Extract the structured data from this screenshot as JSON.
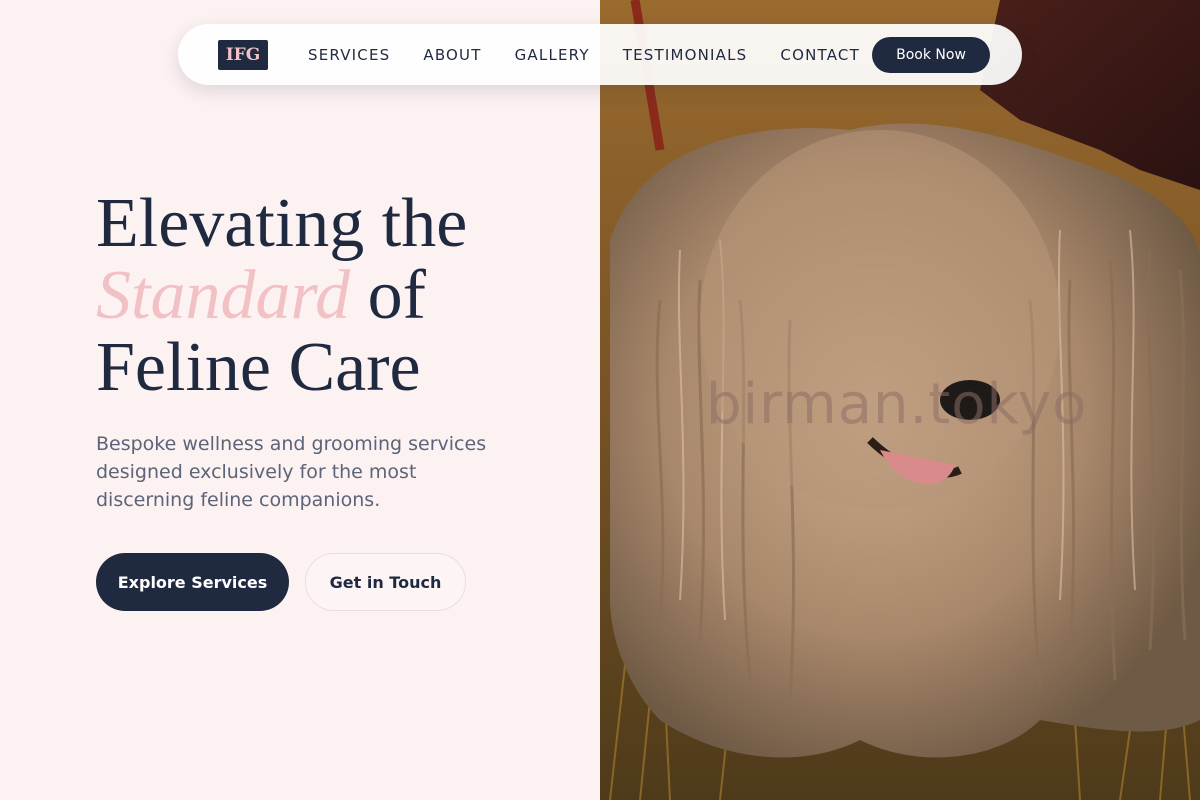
{
  "nav": {
    "logo": "IFG",
    "links": [
      "SERVICES",
      "ABOUT",
      "GALLERY",
      "TESTIMONIALS",
      "CONTACT"
    ],
    "cta": "Book Now"
  },
  "hero": {
    "title_line1": "Elevating the",
    "title_accent": "Standard",
    "title_of": "of",
    "title_line3": "Feline Care",
    "subtitle": "Bespoke wellness and grooming services designed exclusively for the most discerning feline companions.",
    "primary_button": "Explore Services",
    "secondary_button": "Get in Touch",
    "image_watermark": "birman.tokyo"
  },
  "colors": {
    "navy": "#1f2a40",
    "accent_pink": "#f2c1c6",
    "background": "#fdf2f2",
    "body_text": "#5b6478"
  }
}
